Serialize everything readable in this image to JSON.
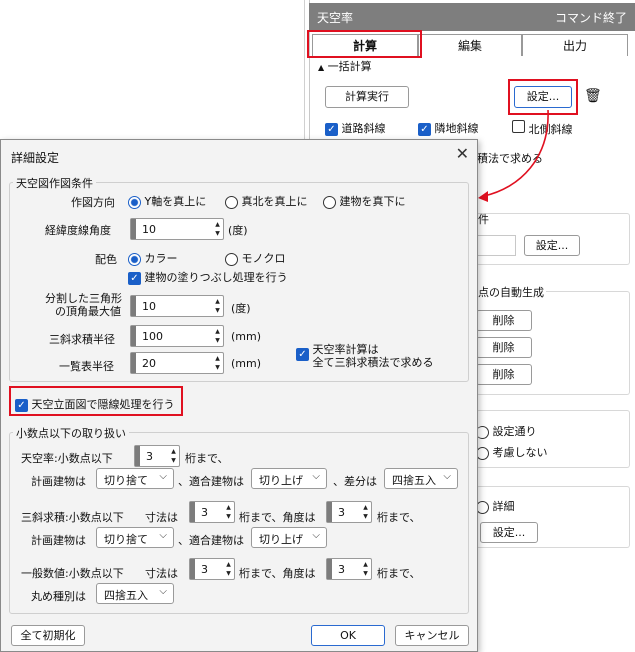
{
  "panel": {
    "title": "天空率",
    "end_label": "コマンド終了",
    "tabs": [
      "計算",
      "編集",
      "出力"
    ],
    "section_label": "一括計算",
    "run_button": "計算実行",
    "settings_button": "設定...",
    "checks": [
      {
        "label": "道路斜線",
        "checked": true
      },
      {
        "label": "隣地斜線",
        "checked": true
      },
      {
        "label": "北側斜線",
        "checked": false
      }
    ],
    "partial_text": "積法で求める",
    "partial_head": "件",
    "settings_button2": "設定...",
    "auto_group_label": "点の自動生成",
    "delete_buttons": [
      "削除",
      "削除",
      "削除"
    ],
    "radio_setting": "設定通り",
    "radio_none": "考慮しない",
    "radio_detail": "詳細",
    "settings_button3": "設定..."
  },
  "dialog": {
    "title": "詳細設定",
    "close": "✕",
    "sky_group": "天空図作図条件",
    "dir_label": "作図方向",
    "dir_options": [
      "Y軸を真上に",
      "真北を真上に",
      "建物を真下に"
    ],
    "grid_label": "経緯度線角度",
    "grid_value": "10",
    "grid_unit": "(度)",
    "color_label": "配色",
    "color_options": [
      "カラー",
      "モノクロ"
    ],
    "fill_label": "建物の塗りつぶし処理を行う",
    "tri_label_1": "分割した三角形",
    "tri_label_2": "の頂角最大値",
    "tri_value": "10",
    "tri_unit": "(度)",
    "radius_label": "三斜求積半径",
    "radius_value": "100",
    "radius_unit": "(mm)",
    "list_label": "一覧表半径",
    "list_value": "20",
    "list_unit": "(mm)",
    "calc_check_1": "天空率計算は",
    "calc_check_2": "全て三斜求積法で求める",
    "hidden_label": "天空立面図で隠線処理を行う",
    "decimal_group": "小数点以下の取り扱い",
    "sky_dec_label": "天空率:小数点以下",
    "sky_dec_value": "3",
    "sky_dec_suffix": "桁まで、",
    "calc_bldg": "計画建物は",
    "fit_bldg": "、適合建物は",
    "diff": "、差分は",
    "opt_truncate": "切り捨て",
    "opt_roundup": "切り上げ",
    "opt_round": "四捨五入",
    "tri_dec_label": "三斜求積:小数点以下",
    "dim_label": "寸法は",
    "dim_value": "3",
    "dim_suffix": "桁まで、角度は",
    "ang_value": "3",
    "ang_suffix": "桁まで、",
    "gen_dec_label": "一般数値:小数点以下",
    "gen_dim_value": "3",
    "gen_ang_value": "3",
    "round_type": "丸め種別は",
    "reset_button": "全て初期化",
    "ok_button": "OK",
    "cancel_button": "キャンセル"
  },
  "colors": {
    "accent": "#1a5fc8",
    "highlight": "#e01020",
    "header": "#7e7e7e"
  }
}
